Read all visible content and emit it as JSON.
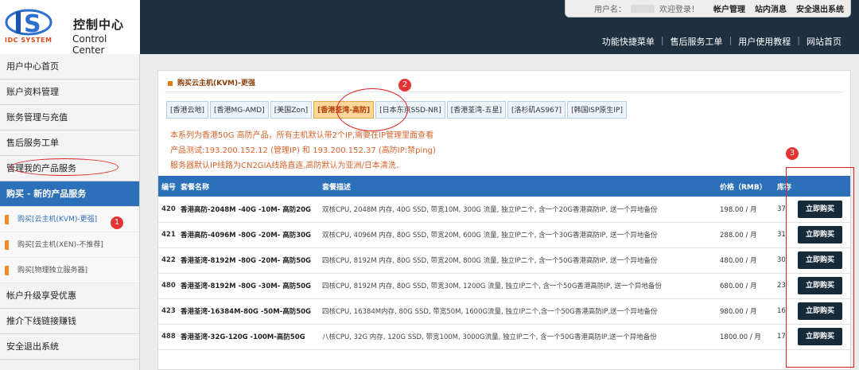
{
  "header": {
    "logo_title": "控制中心",
    "logo_subtitle": "Control Center",
    "logo_brand": "IDC SYSTEM",
    "user_label": "用户名：",
    "welcome": "欢迎登录！",
    "top_links": [
      "帐户管理",
      "站内消息",
      "安全退出系统"
    ],
    "main_nav": [
      "功能快捷菜单",
      "售后服务工单",
      "用户使用教程",
      "网站首页"
    ]
  },
  "sidebar": {
    "items": [
      {
        "label": "用户中心首页"
      },
      {
        "label": "账户资料管理"
      },
      {
        "label": "账务管理与充值"
      },
      {
        "label": "售后服务工单"
      },
      {
        "label": "管理我的产品服务"
      },
      {
        "label": "购买 - 新的产品服务"
      }
    ],
    "subitems": [
      {
        "label": "购买[云主机(KVM)-更强]"
      },
      {
        "label": "购买[云主机(XEN)-不推荐]"
      },
      {
        "label": "购买[物理独立服务器]"
      }
    ],
    "items_after": [
      {
        "label": "帐户升级享受优惠"
      },
      {
        "label": "推介下线链接赚钱"
      },
      {
        "label": "安全退出系统"
      }
    ]
  },
  "panel": {
    "title": "购买云主机(KVM)-更强",
    "tabs": [
      "[香港云地]",
      "[香港MG-AMD]",
      "[美国Zon]",
      "[香港荃湾-高防]",
      "[日本东京SSD-NR]",
      "[香港荃湾-五星]",
      "[洛杉矶AS967]",
      "[韩国ISP原生IP]"
    ],
    "active_tab": 3,
    "notes": [
      "本系列为香港50G 高防产品，所有主机默认带2个IP,需要在IP管理里面查看",
      "产品测试:193.200.152.12 (管理IP) 和 193.200.152.37 (高防IP:禁ping)",
      "服务器默认IP线路为CN2GIA线路直连,高防默认为亚洲/日本清洗."
    ]
  },
  "table": {
    "headers": {
      "id": "编号",
      "name": "套餐名称",
      "desc": "套餐描述",
      "price": "价格（RMB）",
      "stock": "库存",
      "action": ""
    },
    "rows": [
      {
        "id": "420",
        "name": "香港高防-2048M -40G -10M- 高防20G",
        "desc": "双核CPU, 2048M 内存, 40G SSD, 带宽10M, 300G 流量, 独立IP二个, 含一个20G香港高防IP, 送一个异地备份",
        "price": "198.00 / 月",
        "stock": "37",
        "button": "立即购买"
      },
      {
        "id": "421",
        "name": "香港高防-4096M -80G -20M- 高防30G",
        "desc": "双核CPU, 4096M 内存, 80G SSD, 带宽20M, 600G 流量, 独立IP二个, 含一个30G香港高防IP, 送一个异地备份",
        "price": "288.00 / 月",
        "stock": "31",
        "button": "立即购买"
      },
      {
        "id": "422",
        "name": "香港荃湾-8192M -80G -20M- 高防50G",
        "desc": "四核CPU, 8192M 内存, 80G SSD, 带宽20M, 800G 流量, 独立IP二个, 含一个50G香港高防IP, 送一个异地备份",
        "price": "480.00 / 月",
        "stock": "30",
        "button": "立即购买"
      },
      {
        "id": "480",
        "name": "香港荃湾-8192M -80G -30M- 高防50G",
        "desc": "四核CPU, 8192M 内存, 80G SSD, 带宽30M, 1200G 流量, 独立IP二个, 含一个50G香港高防IP, 送一个异地备份",
        "price": "680.00 / 月",
        "stock": "23",
        "button": "立即购买"
      },
      {
        "id": "423",
        "name": "香港荃湾-16384M-80G -50M-高防50G",
        "desc": "四核CPU, 16384M内存, 80G SSD, 带宽50M, 1600G流量, 独立IP二个,含一个50G香港高防IP,送一个异地备份",
        "price": "980.00 / 月",
        "stock": "16",
        "button": "立即购买"
      },
      {
        "id": "488",
        "name": "香港荃湾-32G-120G -100M-高防50G",
        "desc": "八核CPU, 32G 内存, 120G SSD, 带宽100M, 3000G流量, 独立IP二个, 含一个50G香港高防IP,送一个异地备份",
        "price": "1800.00 / 月",
        "stock": "17",
        "button": "立即购买"
      }
    ]
  },
  "annotations": {
    "badge1": "1",
    "badge2": "2",
    "badge3": "3"
  },
  "colors": {
    "header_bg": "#1e2f40",
    "accent_blue": "#2c70ba",
    "buy_button": "#172a3a",
    "note_orange": "#d6622a",
    "annotation_red": "#e02020"
  }
}
